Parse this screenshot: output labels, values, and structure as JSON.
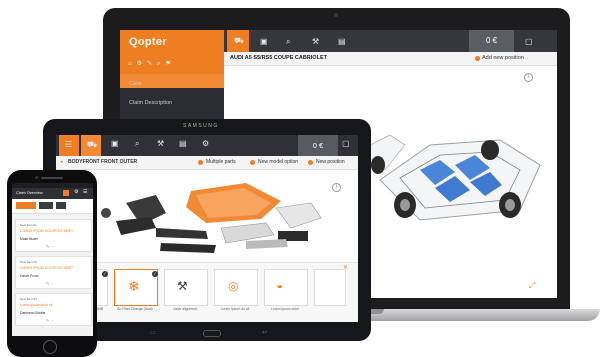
{
  "laptop": {
    "brand_logo": "Qopter",
    "sidebar_items": [
      "Case",
      "Claim Description"
    ],
    "topbar_icons": [
      "car-icon",
      "camera-icon",
      "search-icon",
      "wrench-icon",
      "document-icon"
    ],
    "price": "0 €",
    "car_title": "AUDI A5 S5/RS5 COUPE CABRIOLET",
    "add_position": "Add new position",
    "accent": "#ef7d22"
  },
  "tablet": {
    "brand": "SAMSUNG",
    "part_group": "BODYFRONT FRONT OUTER",
    "actions": [
      "Multiple parts",
      "New model option",
      "New position"
    ],
    "price": "0 €",
    "part_cards": [
      "Oil / Check Oil (...) Refill",
      "Air Filter Change (front)",
      "Valve alignment",
      "Lorem ipsum do sit",
      "Lorem ipsum dolor"
    ]
  },
  "phone": {
    "title": "Claim Overview",
    "cards": [
      {
        "label": "New Item 01",
        "orange": "LOREM IPSUM DOLOR SIT AMET",
        "dark": "Make Buser"
      },
      {
        "label": "New Item 02",
        "orange": "LOREM IPSUM DOLOR SIT AMET",
        "dark": "Oeum Fcorn"
      },
      {
        "label": "New Item 03",
        "orange": "Lorem ipsum dolor sit",
        "dark": "Damseon Burthe"
      }
    ]
  }
}
